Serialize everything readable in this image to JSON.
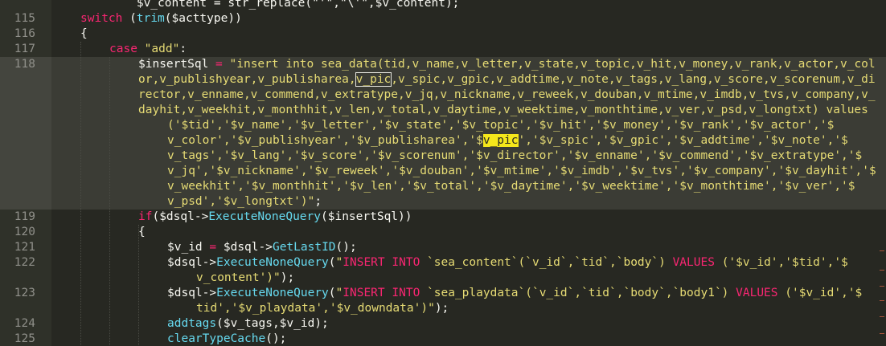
{
  "colors": {
    "background": "#272822",
    "gutter": "#2f3129",
    "keyword": "#f92672",
    "string": "#e6db74",
    "function": "#66d9ef",
    "plain": "#f8f8f2",
    "line_number": "#90908a",
    "selection": "#f5e71b"
  },
  "editor": {
    "current_line": "118",
    "lines": [
      {
        "num": "",
        "indent": 0,
        "tokens": [
          {
            "t": "pl",
            "v": "        $v_content = str_replace(\"'\",\"\\'\",$v_content);"
          }
        ]
      },
      {
        "num": "115",
        "indent": 0,
        "tokens": [
          {
            "t": "kw",
            "v": "switch"
          },
          {
            "t": "pl",
            "v": " ("
          },
          {
            "t": "fn",
            "v": "trim"
          },
          {
            "t": "pl",
            "v": "($acttype))"
          }
        ]
      },
      {
        "num": "116",
        "indent": 0,
        "tokens": [
          {
            "t": "pl",
            "v": "{"
          }
        ]
      },
      {
        "num": "117",
        "indent": 1,
        "tokens": [
          {
            "t": "kw",
            "v": "case"
          },
          {
            "t": "pl",
            "v": " "
          },
          {
            "t": "st",
            "v": "\"add\""
          },
          {
            "t": "pl",
            "v": ":"
          }
        ]
      },
      {
        "num": "118",
        "indent": 2,
        "tokens": [
          {
            "t": "pl",
            "v": "$insertSql "
          },
          {
            "t": "kw",
            "v": "="
          },
          {
            "t": "pl",
            "v": " "
          },
          {
            "t": "st",
            "v": "\"insert into sea_data(tid,v_name,v_letter,v_state,v_topic,v_hit,v_money,v_rank,v_actor,v_col"
          }
        ]
      },
      {
        "num": "",
        "indent": 2,
        "tokens": [
          {
            "t": "st",
            "v": "or,v_publishyear,v_publisharea,"
          },
          {
            "t": "st",
            "v": "v_pic",
            "box": true
          },
          {
            "t": "st",
            "v": ",v_spic,v_gpic,v_addtime,v_note,v_tags,v_lang,v_score,v_scorenum,v_di"
          }
        ]
      },
      {
        "num": "",
        "indent": 2,
        "tokens": [
          {
            "t": "st",
            "v": "rector,v_enname,v_commend,v_extratype,v_jq,v_nickname,v_reweek,v_douban,v_mtime,v_imdb,v_tvs,v_company,v_"
          }
        ]
      },
      {
        "num": "",
        "indent": 2,
        "tokens": [
          {
            "t": "st",
            "v": "dayhit,v_weekhit,v_monthhit,v_len,v_total,v_daytime,v_weektime,v_monthtime,v_ver,v_psd,v_longtxt) values"
          }
        ]
      },
      {
        "num": "",
        "indent": 3,
        "tokens": [
          {
            "t": "st",
            "v": "('$tid','$v_name','$v_letter','$v_state','$v_topic','$v_hit','$v_money','$v_rank','$v_actor','$"
          }
        ]
      },
      {
        "num": "",
        "indent": 3,
        "tokens": [
          {
            "t": "st",
            "v": "v_color','$v_publishyear','$v_publisharea','$"
          },
          {
            "t": "st",
            "v": "v_pic",
            "sel": true
          },
          {
            "t": "st",
            "v": "','$v_spic','$v_gpic','$v_addtime','$v_note','$"
          }
        ]
      },
      {
        "num": "",
        "indent": 3,
        "tokens": [
          {
            "t": "st",
            "v": "v_tags','$v_lang','$v_score','$v_scorenum','$v_director','$v_enname','$v_commend','$v_extratype','$"
          }
        ]
      },
      {
        "num": "",
        "indent": 3,
        "tokens": [
          {
            "t": "st",
            "v": "v_jq','$v_nickname','$v_reweek','$v_douban','$v_mtime','$v_imdb','$v_tvs','$v_company','$v_dayhit','$"
          }
        ]
      },
      {
        "num": "",
        "indent": 3,
        "tokens": [
          {
            "t": "st",
            "v": "v_weekhit','$v_monthhit','$v_len','$v_total','$v_daytime','$v_weektime','$v_monthtime','$v_ver','$"
          }
        ]
      },
      {
        "num": "",
        "indent": 3,
        "tokens": [
          {
            "t": "st",
            "v": "v_psd','$v_longtxt')\""
          },
          {
            "t": "pl",
            "v": ";"
          }
        ]
      },
      {
        "num": "119",
        "indent": 2,
        "tokens": [
          {
            "t": "kw",
            "v": "if"
          },
          {
            "t": "pl",
            "v": "($dsql->"
          },
          {
            "t": "fn",
            "v": "ExecuteNoneQuery"
          },
          {
            "t": "pl",
            "v": "($insertSql))"
          }
        ]
      },
      {
        "num": "120",
        "indent": 2,
        "tokens": [
          {
            "t": "pl",
            "v": "{"
          }
        ]
      },
      {
        "num": "121",
        "indent": 3,
        "tokens": [
          {
            "t": "pl",
            "v": "$v_id "
          },
          {
            "t": "kw",
            "v": "="
          },
          {
            "t": "pl",
            "v": " $dsql->"
          },
          {
            "t": "fn",
            "v": "GetLastID"
          },
          {
            "t": "pl",
            "v": "();"
          }
        ]
      },
      {
        "num": "122",
        "indent": 3,
        "tokens": [
          {
            "t": "pl",
            "v": "$dsql->"
          },
          {
            "t": "fn",
            "v": "ExecuteNoneQuery"
          },
          {
            "t": "pl",
            "v": "("
          },
          {
            "t": "st",
            "v": "\""
          },
          {
            "t": "kw",
            "v": "INSERT INTO"
          },
          {
            "t": "st",
            "v": " `sea_content`(`v_id`,`tid`,`body`) "
          },
          {
            "t": "kw",
            "v": "VALUES"
          },
          {
            "t": "st",
            "v": " ('$v_id','$tid','$"
          }
        ]
      },
      {
        "num": "",
        "indent": 4,
        "tokens": [
          {
            "t": "st",
            "v": "v_content')\""
          },
          {
            "t": "pl",
            "v": ");"
          }
        ]
      },
      {
        "num": "123",
        "indent": 3,
        "tokens": [
          {
            "t": "pl",
            "v": "$dsql->"
          },
          {
            "t": "fn",
            "v": "ExecuteNoneQuery"
          },
          {
            "t": "pl",
            "v": "("
          },
          {
            "t": "st",
            "v": "\""
          },
          {
            "t": "kw",
            "v": "INSERT INTO"
          },
          {
            "t": "st",
            "v": " `sea_playdata`(`v_id`,`tid`,`body`,`body1`) "
          },
          {
            "t": "kw",
            "v": "VALUES"
          },
          {
            "t": "st",
            "v": " ('$v_id','$"
          }
        ]
      },
      {
        "num": "",
        "indent": 4,
        "tokens": [
          {
            "t": "st",
            "v": "tid','$v_playdata','$v_downdata')\""
          },
          {
            "t": "pl",
            "v": ");"
          }
        ]
      },
      {
        "num": "124",
        "indent": 3,
        "tokens": [
          {
            "t": "fn",
            "v": "addtags"
          },
          {
            "t": "pl",
            "v": "($v_tags,$v_id);"
          }
        ]
      },
      {
        "num": "125",
        "indent": 3,
        "tokens": [
          {
            "t": "fn",
            "v": "clearTypeCache"
          },
          {
            "t": "pl",
            "v": "();"
          }
        ]
      }
    ]
  }
}
